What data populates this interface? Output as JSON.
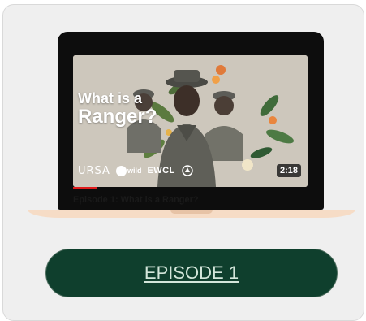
{
  "video": {
    "headline_line1": "What is a",
    "headline_line2": "Ranger?",
    "duration": "2:18",
    "title": "Episode 1: What is a Ranger?",
    "watched_fraction": 0.1,
    "logos": {
      "ursa": "URSA",
      "rewild": "wild",
      "ewcl": "EWCL"
    }
  },
  "cta": {
    "label": "EPISODE 1"
  },
  "colors": {
    "button_bg": "#0f3f2d",
    "button_text": "#d3e6da",
    "laptop_base": "#f6dcc6",
    "progress": "#e01b1b"
  }
}
